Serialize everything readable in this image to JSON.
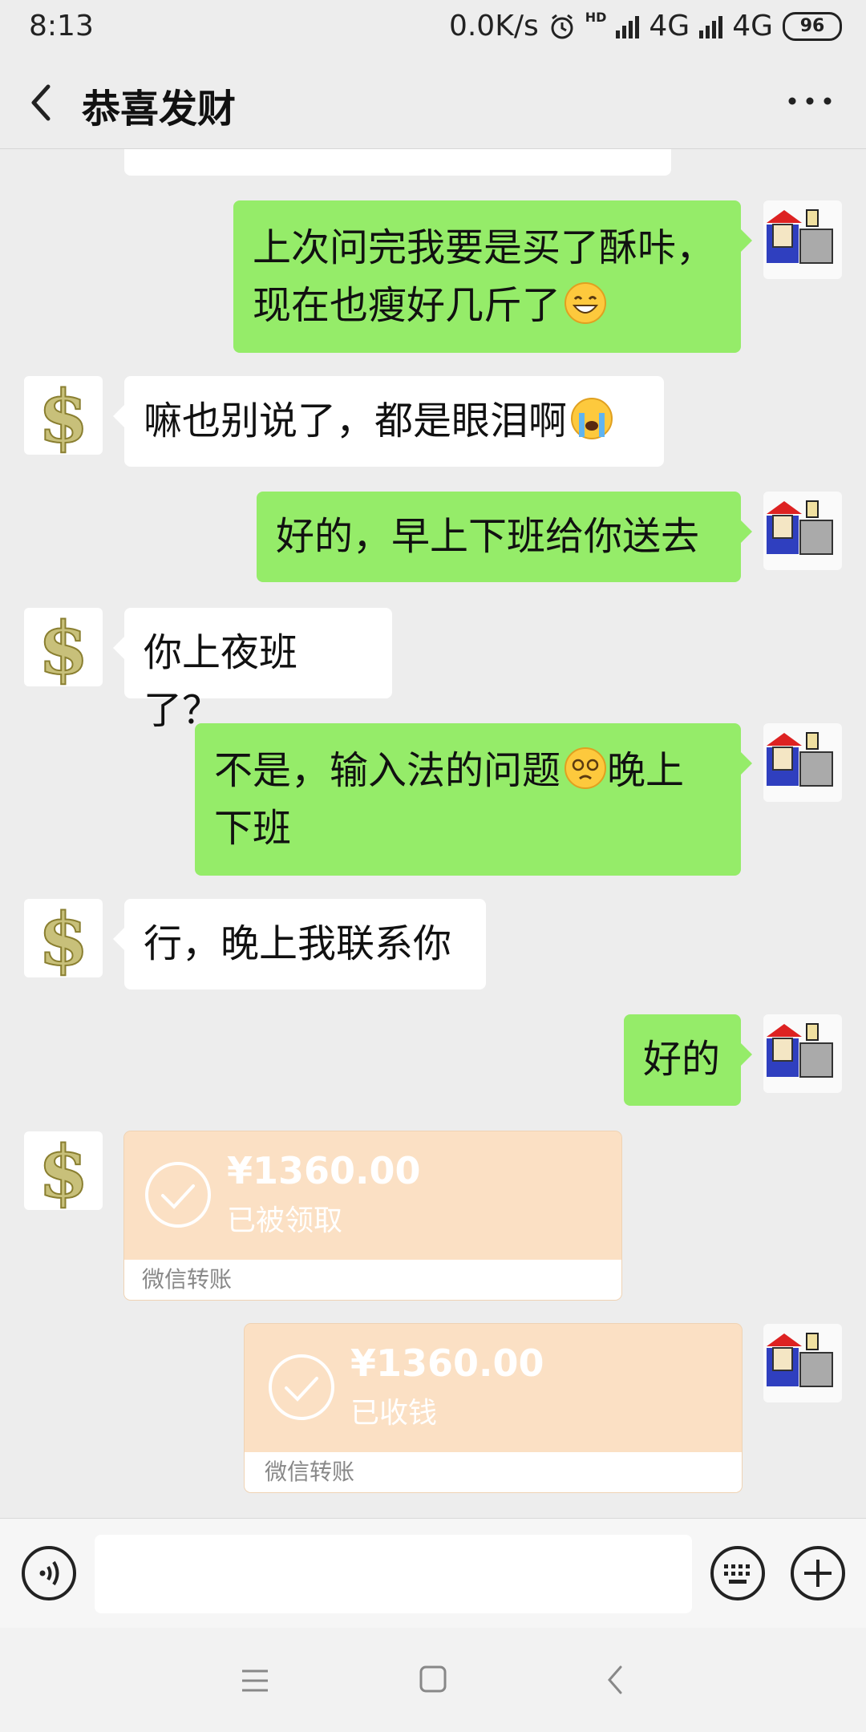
{
  "status_bar": {
    "time": "8:13",
    "net_speed": "0.0K/s",
    "network_1": "4G",
    "network_2": "4G",
    "battery": "96",
    "hd_label": "HD"
  },
  "header": {
    "title": "恭喜发财",
    "back_icon": "chevron-left",
    "more_icon": "ellipsis"
  },
  "messages": [
    {
      "side": "out",
      "text_lines": [
        "上次问完我要是买了酥咔，",
        "现在也瘦好几斤了"
      ],
      "emoji": "grinning-sweat"
    },
    {
      "side": "in",
      "text": "嘛也别说了，都是眼泪啊",
      "emoji": "loudly-crying"
    },
    {
      "side": "out",
      "text": "好的，早上下班给你送去"
    },
    {
      "side": "in",
      "text": "你上夜班了？"
    },
    {
      "side": "out",
      "text_a": "不是，输入法的问题",
      "text_b": "晚上",
      "text_c": "下班",
      "emoji": "dizzy-face"
    },
    {
      "side": "in",
      "text": "行，晚上我联系你"
    },
    {
      "side": "out",
      "text": "好的"
    }
  ],
  "transfers": [
    {
      "side": "in",
      "amount": "¥1360.00",
      "status": "已被领取",
      "label": "微信转账"
    },
    {
      "side": "out",
      "amount": "¥1360.00",
      "status": "已收钱",
      "label": "微信转账"
    }
  ],
  "input_bar": {
    "voice_icon": "voice",
    "keyboard_icon": "keyboard",
    "plus_icon": "plus",
    "input_value": ""
  },
  "nav_bar": {
    "icons": [
      "menu",
      "home",
      "back"
    ]
  },
  "colors": {
    "background": "#ededed",
    "outgoing_bubble": "#95ec69",
    "incoming_bubble": "#ffffff",
    "transfer_card": "#fbe0c4"
  }
}
